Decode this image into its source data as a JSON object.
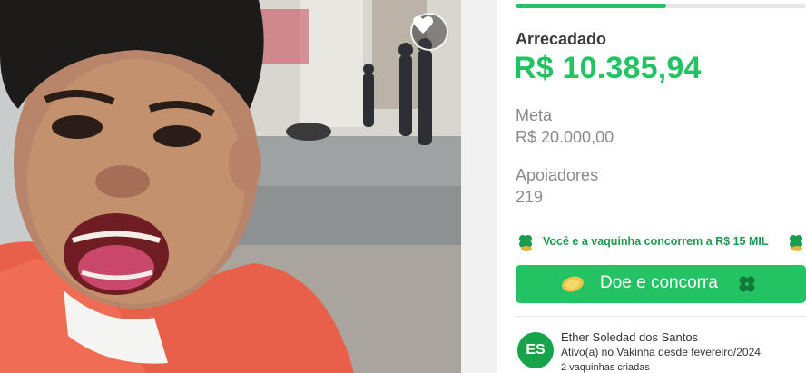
{
  "campaign": {
    "photo_alt": "",
    "favorite_icon": "heart-icon"
  },
  "stats": {
    "progress_fraction": 0.52,
    "raised_label": "Arrecadado",
    "raised_value": "R$ 10.385,94",
    "goal_label": "Meta",
    "goal_value": "R$ 20.000,00",
    "supporters_label": "Apoiadores",
    "supporters_value": "219"
  },
  "promo": {
    "text": "Você e a vaquinha concorrem a R$ 15 MIL",
    "icon": "clover-icon"
  },
  "donate": {
    "label": "Doe e concorra",
    "coin_icon": "coin-icon",
    "clover_icon": "clover-icon"
  },
  "owner": {
    "initials": "ES",
    "name": "Ether Soledad dos Santos",
    "since": "Ativo(a) no Vakinha desde fevereiro/2024",
    "campaigns": "2 vaquinhas criadas"
  },
  "colors": {
    "accent": "#23c263",
    "accent_dark": "#1e9b52",
    "muted_text": "#8a8a8a"
  }
}
